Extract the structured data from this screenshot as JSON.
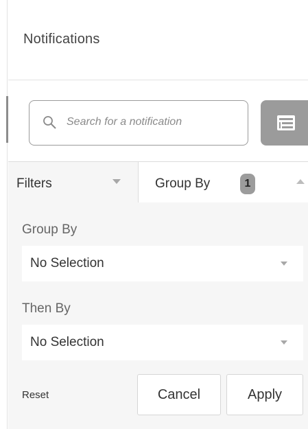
{
  "header": {
    "title": "Notifications"
  },
  "search": {
    "placeholder": "Search for a notification"
  },
  "toolbar": {
    "group_icon": "group-list-icon"
  },
  "tabs": {
    "filters": {
      "label": "Filters"
    },
    "group_by": {
      "label": "Group By",
      "badge": "1"
    }
  },
  "grouping": {
    "group_by": {
      "label": "Group By",
      "value": "No Selection"
    },
    "then_by": {
      "label": "Then By",
      "value": "No Selection"
    }
  },
  "actions": {
    "reset": "Reset",
    "cancel": "Cancel",
    "apply": "Apply"
  },
  "colors": {
    "button_gray": "#9b9b9b",
    "panel_bg": "#f6f6f6",
    "border": "#dcdcdc"
  }
}
